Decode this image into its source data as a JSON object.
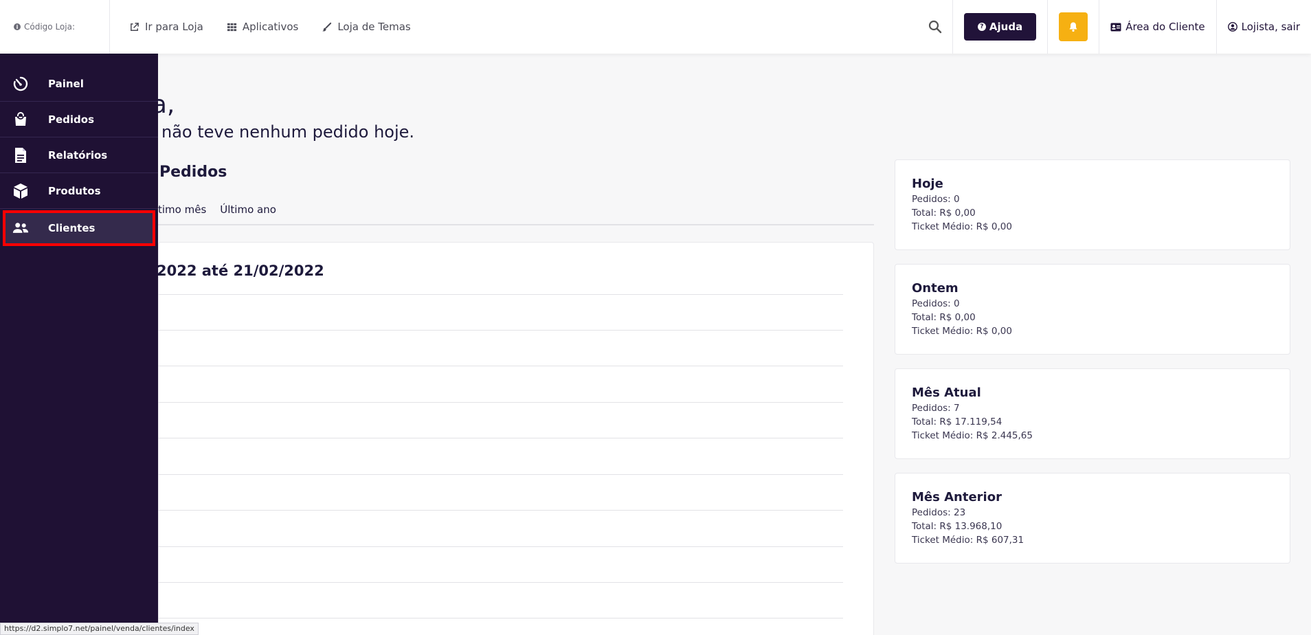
{
  "topbar": {
    "store_code_label": "Código Loja:",
    "links": [
      {
        "label": "Ir para Loja",
        "icon": "external-link-icon"
      },
      {
        "label": "Aplicativos",
        "icon": "grid-icon"
      },
      {
        "label": "Loja de Temas",
        "icon": "brush-icon"
      }
    ],
    "help_label": "Ajuda",
    "client_area_label": "Área do Cliente",
    "user_label": "Lojista, sair",
    "colors": {
      "help_bg": "#211339",
      "bell_bg": "#f6b012"
    }
  },
  "sidebar": {
    "items": [
      {
        "label": "Painel",
        "icon": "dashboard-icon"
      },
      {
        "label": "Pedidos",
        "icon": "shopping-bag-icon"
      },
      {
        "label": "Relatórios",
        "icon": "document-icon"
      },
      {
        "label": "Produtos",
        "icon": "box-icon"
      },
      {
        "label": "Clientes",
        "icon": "users-icon",
        "active": true
      }
    ],
    "colors": {
      "bg": "#1f1134",
      "active_outline": "#ff0000"
    }
  },
  "main": {
    "greeting_title": "sta,",
    "greeting_sub": "não teve nenhum pedido hoje.",
    "orders_title": "Pedidos",
    "period_tabs": [
      "timo mês",
      "Último ano"
    ],
    "range_title": "2022 até 21/02/2022"
  },
  "stats": [
    {
      "title": "Hoje",
      "pedidos": "Pedidos: 0",
      "total": "Total: R$ 0,00",
      "ticket": "Ticket Médio: R$ 0,00"
    },
    {
      "title": "Ontem",
      "pedidos": "Pedidos: 0",
      "total": "Total: R$ 0,00",
      "ticket": "Ticket Médio: R$ 0,00"
    },
    {
      "title": "Mês Atual",
      "pedidos": "Pedidos: 7",
      "total": "Total: R$ 17.119,54",
      "ticket": "Ticket Médio: R$ 2.445,65"
    },
    {
      "title": "Mês Anterior",
      "pedidos": "Pedidos: 23",
      "total": "Total: R$ 13.968,10",
      "ticket": "Ticket Médio: R$ 607,31"
    }
  ],
  "status_url": "https://d2.simplo7.net/painel/venda/clientes/index"
}
